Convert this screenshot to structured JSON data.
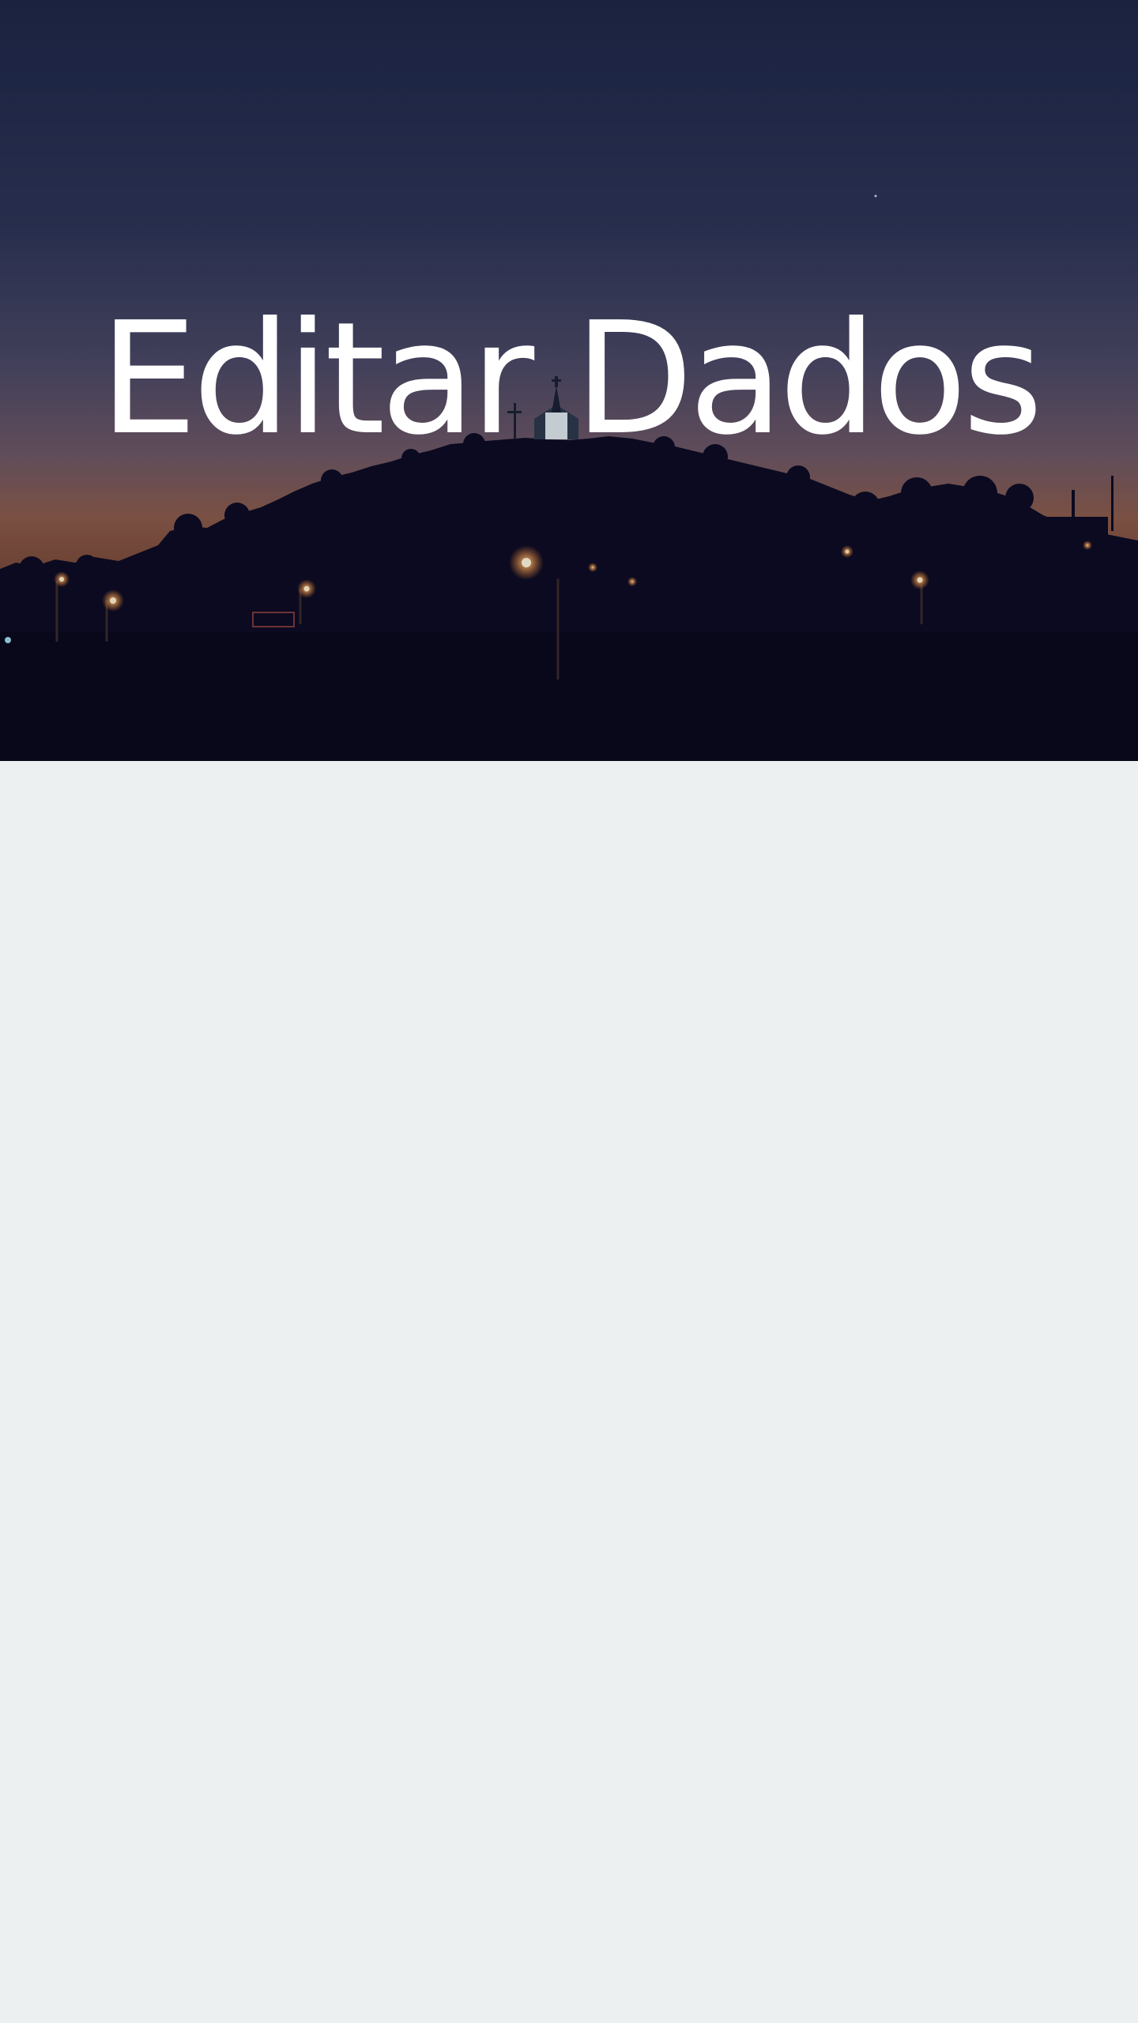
{
  "hero": {
    "title": "Editar Dados",
    "background_image": "night-hill-chapel-landscape",
    "sky_top_color": "#1e2746",
    "sky_horizon_color": "#b0643a",
    "silhouette_color": "#0b0a1e"
  },
  "page": {
    "background_color": "#ecf0f1"
  }
}
